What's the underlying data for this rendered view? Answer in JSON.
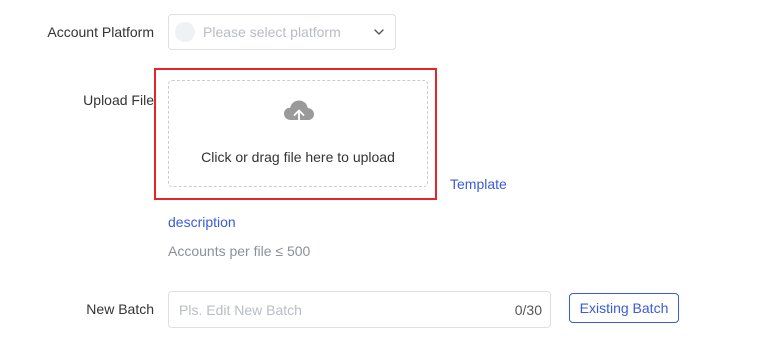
{
  "platform": {
    "label": "Account Platform",
    "placeholder": "Please select platform",
    "icon": "chevron-down-icon"
  },
  "upload": {
    "label": "Upload File",
    "dropzone_text": "Click or drag file here to upload",
    "icon": "cloud-upload-icon",
    "template_link": "Template",
    "description_link": "description",
    "hint": "Accounts per file ≤ 500"
  },
  "batch": {
    "label": "New Batch",
    "placeholder": "Pls. Edit New Batch",
    "count": "0/30",
    "existing_button": "Existing Batch"
  },
  "colors": {
    "accent": "#3a5bd9",
    "highlight": "#e5252a"
  }
}
